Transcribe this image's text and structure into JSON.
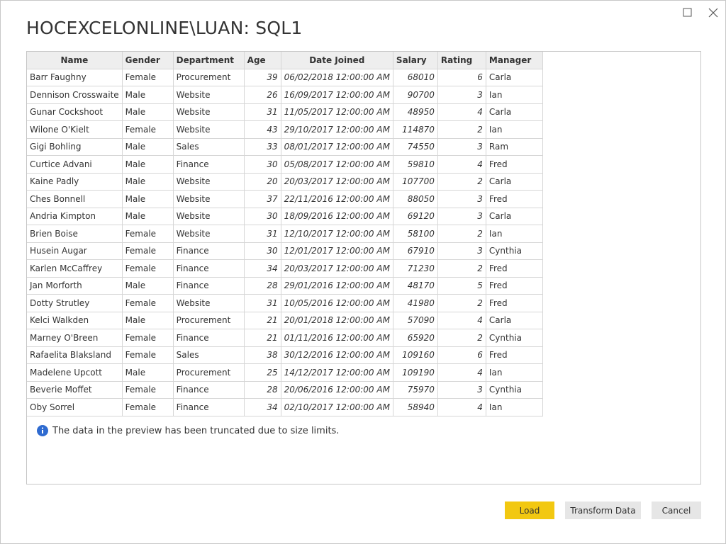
{
  "title": "HOCEXCELONLINE\\LUAN: SQL1",
  "columns": [
    "Name",
    "Gender",
    "Department",
    "Age",
    "Date Joined",
    "Salary",
    "Rating",
    "Manager"
  ],
  "rows": [
    [
      "Barr Faughny",
      "Female",
      "Procurement",
      "39",
      "06/02/2018 12:00:00 AM",
      "68010",
      "6",
      "Carla"
    ],
    [
      "Dennison Crosswaite",
      "Male",
      "Website",
      "26",
      "16/09/2017 12:00:00 AM",
      "90700",
      "3",
      "Ian"
    ],
    [
      "Gunar Cockshoot",
      "Male",
      "Website",
      "31",
      "11/05/2017 12:00:00 AM",
      "48950",
      "4",
      "Carla"
    ],
    [
      "Wilone O'Kielt",
      "Female",
      "Website",
      "43",
      "29/10/2017 12:00:00 AM",
      "114870",
      "2",
      "Ian"
    ],
    [
      "Gigi Bohling",
      "Male",
      "Sales",
      "33",
      "08/01/2017 12:00:00 AM",
      "74550",
      "3",
      "Ram"
    ],
    [
      "Curtice Advani",
      "Male",
      "Finance",
      "30",
      "05/08/2017 12:00:00 AM",
      "59810",
      "4",
      "Fred"
    ],
    [
      "Kaine Padly",
      "Male",
      "Website",
      "20",
      "20/03/2017 12:00:00 AM",
      "107700",
      "2",
      "Carla"
    ],
    [
      "Ches Bonnell",
      "Male",
      "Website",
      "37",
      "22/11/2016 12:00:00 AM",
      "88050",
      "3",
      "Fred"
    ],
    [
      "Andria Kimpton",
      "Male",
      "Website",
      "30",
      "18/09/2016 12:00:00 AM",
      "69120",
      "3",
      "Carla"
    ],
    [
      "Brien Boise",
      "Female",
      "Website",
      "31",
      "12/10/2017 12:00:00 AM",
      "58100",
      "2",
      "Ian"
    ],
    [
      "Husein Augar",
      "Female",
      "Finance",
      "30",
      "12/01/2017 12:00:00 AM",
      "67910",
      "3",
      "Cynthia"
    ],
    [
      "Karlen McCaffrey",
      "Female",
      "Finance",
      "34",
      "20/03/2017 12:00:00 AM",
      "71230",
      "2",
      "Fred"
    ],
    [
      "Jan Morforth",
      "Male",
      "Finance",
      "28",
      "29/01/2016 12:00:00 AM",
      "48170",
      "5",
      "Fred"
    ],
    [
      "Dotty Strutley",
      "Female",
      "Website",
      "31",
      "10/05/2016 12:00:00 AM",
      "41980",
      "2",
      "Fred"
    ],
    [
      "Kelci Walkden",
      "Male",
      "Procurement",
      "21",
      "20/01/2018 12:00:00 AM",
      "57090",
      "4",
      "Carla"
    ],
    [
      "Marney O'Breen",
      "Female",
      "Finance",
      "21",
      "01/11/2016 12:00:00 AM",
      "65920",
      "2",
      "Cynthia"
    ],
    [
      "Rafaelita Blaksland",
      "Female",
      "Sales",
      "38",
      "30/12/2016 12:00:00 AM",
      "109160",
      "6",
      "Fred"
    ],
    [
      "Madelene Upcott",
      "Male",
      "Procurement",
      "25",
      "14/12/2017 12:00:00 AM",
      "109190",
      "4",
      "Ian"
    ],
    [
      "Beverie Moffet",
      "Female",
      "Finance",
      "28",
      "20/06/2016 12:00:00 AM",
      "75970",
      "3",
      "Cynthia"
    ],
    [
      "Oby Sorrel",
      "Female",
      "Finance",
      "34",
      "02/10/2017 12:00:00 AM",
      "58940",
      "4",
      "Ian"
    ]
  ],
  "info_message": "The data in the preview has been truncated due to size limits.",
  "buttons": {
    "load": "Load",
    "transform": "Transform Data",
    "cancel": "Cancel"
  },
  "colors": {
    "primary_button": "#f2c811",
    "info_icon": "#2f6bd0",
    "header_bg": "#eeeeee"
  },
  "icons": {
    "maximize": "maximize-icon",
    "close": "close-icon",
    "info": "info-icon"
  }
}
